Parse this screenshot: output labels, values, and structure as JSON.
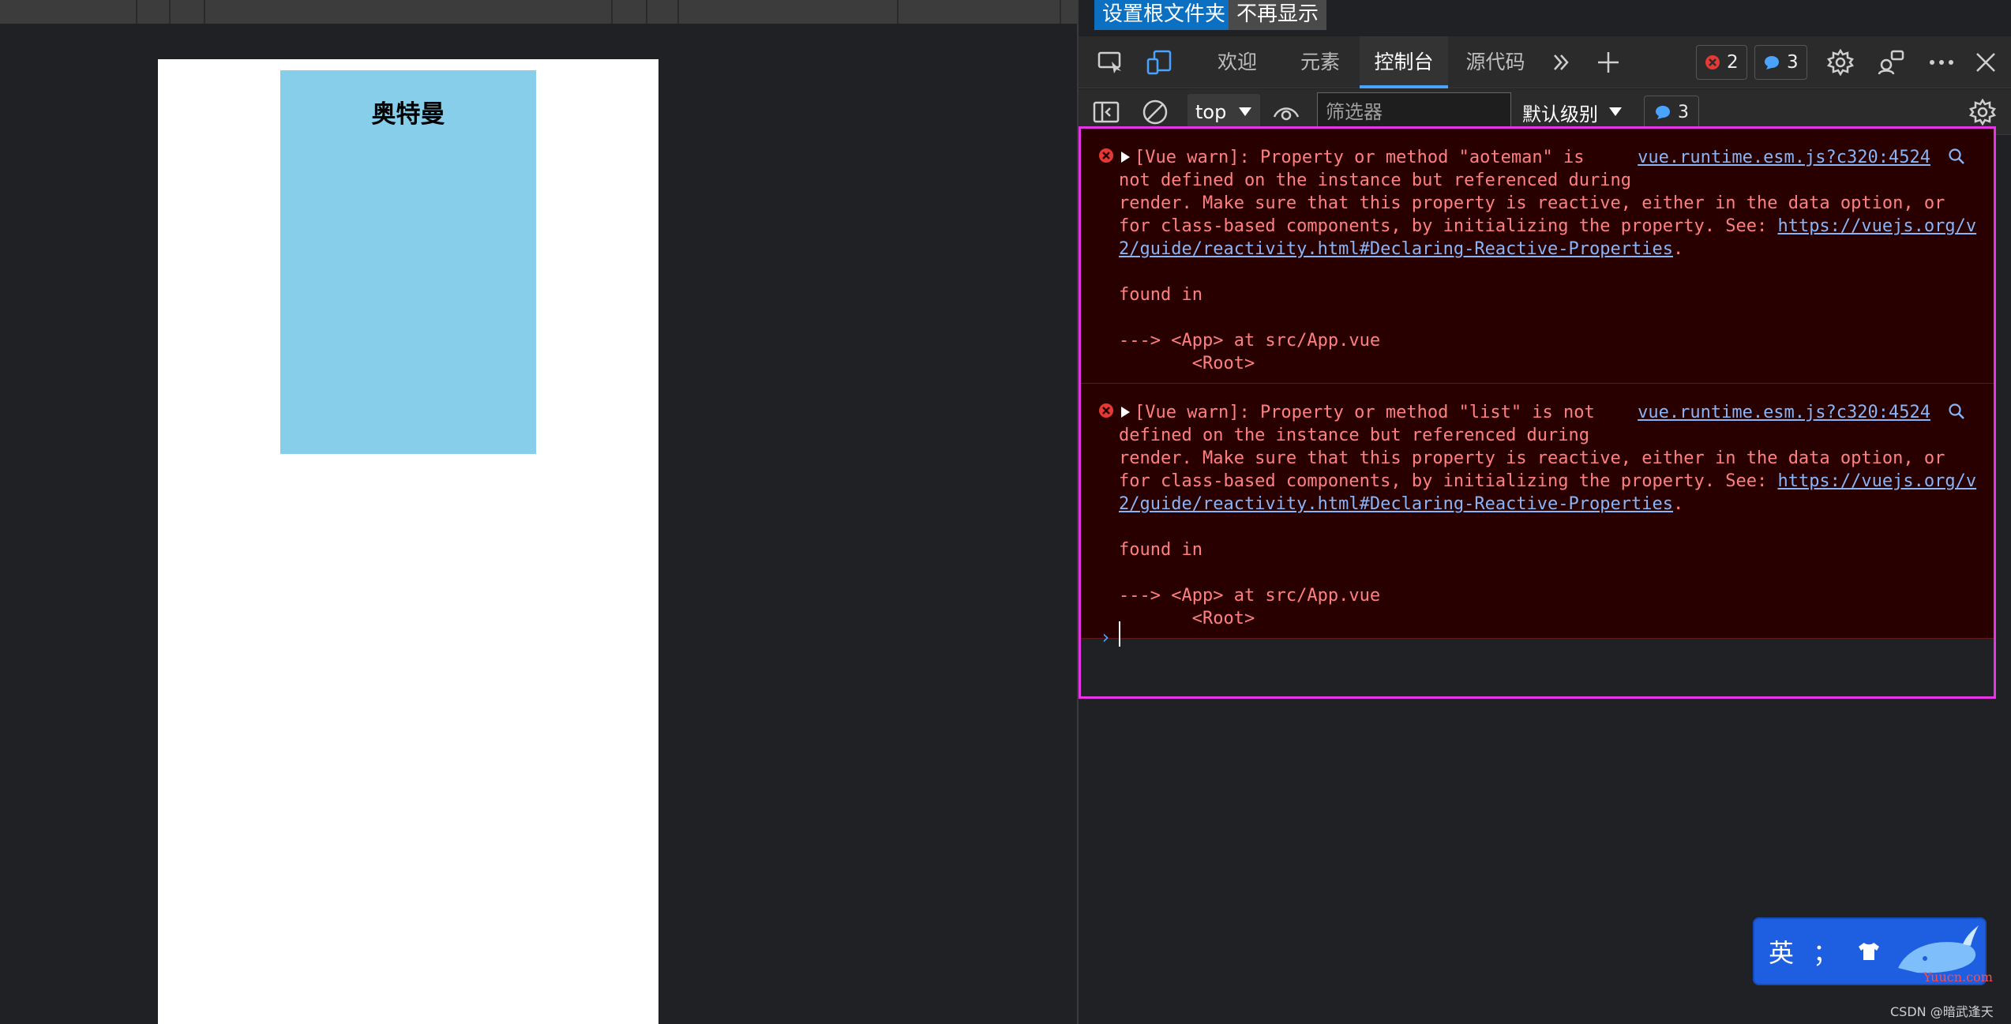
{
  "page": {
    "card_title": "奥特曼"
  },
  "devtools": {
    "notification": {
      "set_root_label": "设置根文件夹",
      "dont_show_label": "不再显示"
    },
    "tabs": [
      {
        "label": "欢迎"
      },
      {
        "label": "元素"
      },
      {
        "label": "控制台"
      },
      {
        "label": "源代码"
      }
    ],
    "error_count": "2",
    "info_count": "3",
    "console_toolbar": {
      "context": "top",
      "filter_placeholder": "筛选器",
      "level": "默认级别",
      "info_count": "3"
    },
    "messages": [
      {
        "line1": "[Vue warn]: Property or method \"aoteman\" is",
        "line2": "not defined on the instance but referenced during",
        "line3": "render. Make sure that this property is reactive, either in the data option, or",
        "line4_prefix": "for class-based components, by initializing the property. See: ",
        "link_part1": "https://vuejs.org/v",
        "link_part2": "2/guide/reactivity.html#Declaring-Reactive-Properties",
        "link_suffix": ".",
        "found_in": "found in",
        "trace1": "---> <App> at src/App.vue",
        "trace2": "       <Root>",
        "source": "vue.runtime.esm.js?c320:4524"
      },
      {
        "line1": "[Vue warn]: Property or method \"list\" is not",
        "line2": "defined on the instance but referenced during",
        "line3": "render. Make sure that this property is reactive, either in the data option, or",
        "line4_prefix": "for class-based components, by initializing the property. See: ",
        "link_part1": "https://vuejs.org/v",
        "link_part2": "2/guide/reactivity.html#Declaring-Reactive-Properties",
        "link_suffix": ".",
        "found_in": "found in",
        "trace1": "---> <App> at src/App.vue",
        "trace2": "       <Root>",
        "source": "vue.runtime.esm.js?c320:4524"
      }
    ]
  },
  "ime": {
    "mode": "英",
    "punct": "；"
  },
  "watermarks": {
    "ime_site": "Yuucn.com",
    "csdn": "CSDN @暗武逢天"
  },
  "colors": {
    "card_bg": "#87ceeb",
    "error_text": "#ff8080",
    "error_bg": "#290000",
    "link": "#8ab4f8",
    "highlight_border": "#e535e5",
    "primary_button": "#0b6fc2"
  }
}
